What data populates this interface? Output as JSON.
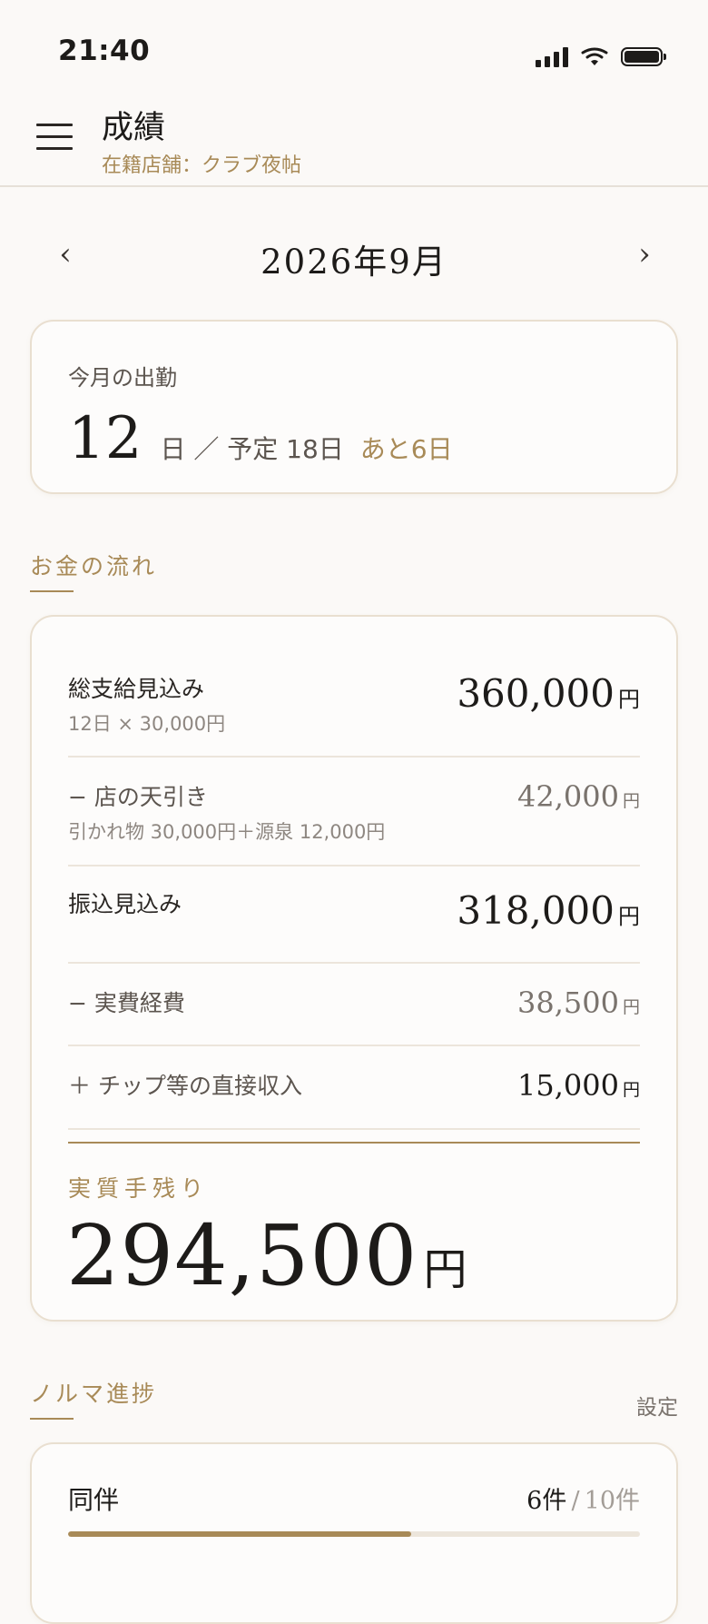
{
  "status_bar": {
    "time": "21:40"
  },
  "header": {
    "title": "成績",
    "subtitle": "在籍店舗：クラブ夜帖"
  },
  "month_nav": {
    "prev": "‹",
    "label": "2026年9月",
    "next": "›"
  },
  "attendance": {
    "label": "今月の出勤",
    "days": "12",
    "unit_text": "日 ／ 予定 18日",
    "remaining": "あと6日"
  },
  "money_flow": {
    "section_title": "お金の流れ",
    "rows": [
      {
        "label": "総支給見込み",
        "sub": "12日 × 30,000円",
        "amount": "360,000",
        "yen": "円"
      },
      {
        "label": "− 店の天引き",
        "sub": "引かれ物 30,000円＋源泉 12,000円",
        "amount": "42,000",
        "yen": "円"
      },
      {
        "label": "振込見込み",
        "amount": "318,000",
        "yen": "円"
      },
      {
        "label": "− 実費経費",
        "amount": "38,500",
        "yen": "円"
      },
      {
        "label": "＋ チップ等の直接収入",
        "amount": "15,000",
        "yen": "円"
      }
    ],
    "net_label": "実質手残り",
    "net_amount": "294,500",
    "net_yen": "円"
  },
  "quota": {
    "section_title": "ノルマ進捗",
    "settings_label": "設定",
    "items": [
      {
        "label": "同伴",
        "current": "6件",
        "separator": "/",
        "target": "10件",
        "progress": 0.6
      }
    ]
  },
  "colors": {
    "accent": "#a88a57",
    "background": "#fbf9f7",
    "text": "#1d1b19"
  }
}
